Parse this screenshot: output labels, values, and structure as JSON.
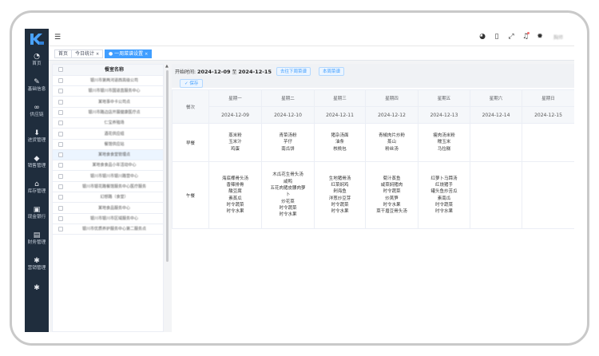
{
  "sidebar": {
    "items": [
      {
        "label": "首页",
        "icon": "dashboard-icon"
      },
      {
        "label": "基础信息",
        "icon": "edit-icon"
      },
      {
        "label": "供应链",
        "icon": "link-icon"
      },
      {
        "label": "进货管理",
        "icon": "download-icon"
      },
      {
        "label": "销售管理",
        "icon": "tag-icon"
      },
      {
        "label": "库存管理",
        "icon": "home-icon"
      },
      {
        "label": "现金银行",
        "icon": "bank-icon"
      },
      {
        "label": "财务管理",
        "icon": "wallet-icon"
      },
      {
        "label": "营销管理",
        "icon": "gear-icon"
      },
      {
        "label": "",
        "icon": "settings-icon"
      }
    ]
  },
  "topbar": {
    "user_name": "胸师"
  },
  "tags": [
    {
      "label": "首页",
      "active": false
    },
    {
      "label": "今日统计",
      "active": false,
      "close": "×"
    },
    {
      "label": "● 一周菜谱设置",
      "active": true,
      "close": "×"
    }
  ],
  "left_list": {
    "header": "餐室名称",
    "rows": [
      "银川市第两河道西高级公司",
      "银川市银川市国道直服务中心",
      "某地事中卡公司点",
      "银川市路边店开展健康医疗点",
      "仁宝养殖场",
      "酒花供应组",
      "餐馆供应站",
      "某地食食堂管理点",
      "某地食食品小年活动中心",
      "银川市银川市银川路营中心",
      "银川市银花路餐馆服务中心医疗服务",
      "幻想路（食堂）",
      "某地食品服务中心",
      "银川市银川市区域服务中心",
      "银川市优质养护服务中心第二服务点"
    ],
    "selected_index": 7
  },
  "main": {
    "period_label": "开始时间:",
    "start_date": "2024-12-09",
    "to_label": "至",
    "end_date": "2024-12-15",
    "next_week_btn": "去往下周菜谱",
    "this_week_btn": "本周菜谱",
    "save_btn": "✓ 保存",
    "corner": "餐次",
    "days": [
      "星期一",
      "星期二",
      "星期三",
      "星期四",
      "星期五",
      "星期六",
      "星期日"
    ],
    "dates": [
      "2024-12-09",
      "2024-12-10",
      "2024-12-11",
      "2024-12-12",
      "2024-12-13",
      "2024-12-14",
      "2024-12-15"
    ],
    "meals": [
      {
        "name": "早餐",
        "days": [
          [
            "蒸米粉",
            "玉米汁",
            "鸡蛋"
          ],
          [
            "青菜汤粉",
            "芋仔",
            "南瓜饼"
          ],
          [
            "猪杂汤面",
            "油条",
            "核桃包"
          ],
          [
            "青椒肉片炒粉",
            "蒸山",
            "粉丝汤"
          ],
          [
            "瘦肉汤米粉",
            "糯玉米",
            "马拉糕"
          ],
          [],
          []
        ]
      },
      {
        "name": "午餐",
        "days": [
          [
            "海底椰骨头汤",
            "香辣排骨",
            "酸豆腐",
            "素蒸瓜",
            "时令蔬菜",
            "时令水果"
          ],
          [
            "木瓜花生骨头汤",
            "咸鸭",
            "五花肉猪皮腰肉萝",
            "卜",
            "炒花菜",
            "时令蔬菜",
            "时令水果"
          ],
          [
            "生地猪骨汤",
            "红菜焖鸡",
            "剁海鱼",
            "洋葱炒豆芽",
            "时令蔬菜",
            "时令水果"
          ],
          [
            "菊汁蒸鱼",
            "咸菜焖猪肉",
            "时令蔬菜",
            "炒莴笋",
            "时令水果",
            "菜干眉豆骨头汤"
          ],
          [
            "红萝卜马蹄汤",
            "红烧猪手",
            "罐头鱼炒苦瓜",
            "素南瓜",
            "时令蔬菜",
            "时令水果"
          ],
          [],
          []
        ]
      }
    ]
  }
}
